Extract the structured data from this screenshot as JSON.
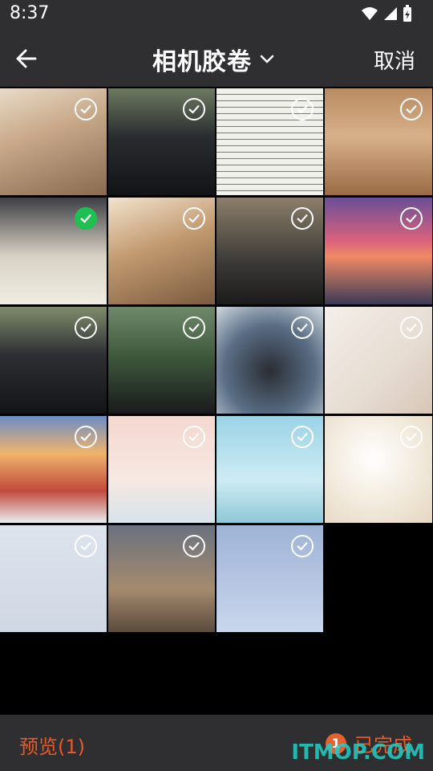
{
  "status": {
    "time": "8:37"
  },
  "header": {
    "title": "相机胶卷",
    "cancel": "取消"
  },
  "grid": {
    "tiles": [
      {
        "selected": false
      },
      {
        "selected": false
      },
      {
        "selected": false
      },
      {
        "selected": false
      },
      {
        "selected": true
      },
      {
        "selected": false
      },
      {
        "selected": false
      },
      {
        "selected": false
      },
      {
        "selected": false
      },
      {
        "selected": false
      },
      {
        "selected": false
      },
      {
        "selected": false
      },
      {
        "selected": false
      },
      {
        "selected": false
      },
      {
        "selected": false
      },
      {
        "selected": false
      },
      {
        "selected": false
      },
      {
        "selected": false
      },
      {
        "selected": false
      }
    ]
  },
  "footer": {
    "preview": "预览(1)",
    "badge": "1",
    "done": "已完成"
  },
  "watermark": "ITMOP.COM",
  "colors": {
    "accent": "#e55a2b",
    "check_on": "#1fbf52",
    "bar": "#2f2f31"
  }
}
